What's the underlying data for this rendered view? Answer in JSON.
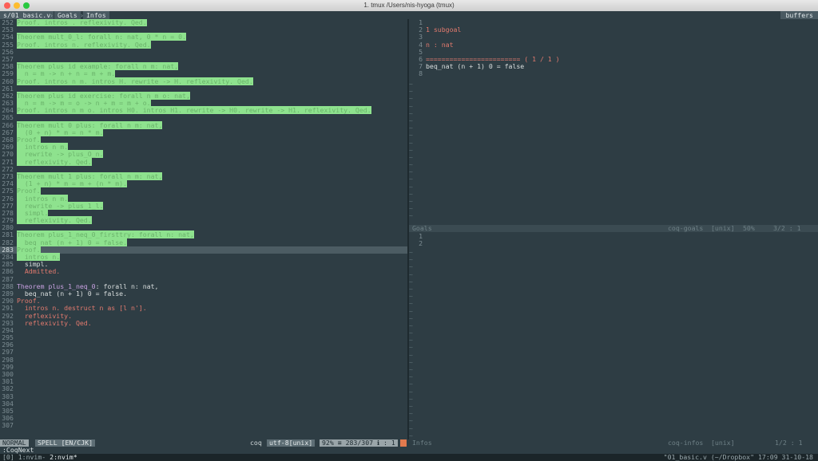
{
  "window": {
    "title": "1. tmux  /Users/nis-hyoga (tmux)"
  },
  "tabline": {
    "tabs": [
      "s/01_basic.v",
      "Goals",
      "Infos"
    ],
    "buffers_label": "buffers"
  },
  "left_pane": {
    "lines": [
      {
        "n": "252",
        "segs": [
          {
            "t": "Proof. intros . reflexivity. Qed.",
            "c": "hl"
          }
        ]
      },
      {
        "n": "253",
        "segs": []
      },
      {
        "n": "254",
        "segs": [
          {
            "t": "Theorem mult_0_l: forall n: nat, 0 * n = 0.",
            "c": "hl"
          }
        ]
      },
      {
        "n": "255",
        "segs": [
          {
            "t": "Proof. intros n. reflexivity. Qed.",
            "c": "hl"
          }
        ]
      },
      {
        "n": "256",
        "segs": []
      },
      {
        "n": "257",
        "segs": []
      },
      {
        "n": "258",
        "segs": [
          {
            "t": "Theorem plus_id_example: forall n m: nat,",
            "c": "hl"
          }
        ]
      },
      {
        "n": "259",
        "segs": [
          {
            "t": "  n = m -> n + n = m + m.",
            "c": "hl"
          }
        ]
      },
      {
        "n": "260",
        "segs": [
          {
            "t": "Proof. intros n m. intros H. rewrite -> H. reflexivity. Qed.",
            "c": "hl"
          }
        ]
      },
      {
        "n": "261",
        "segs": []
      },
      {
        "n": "262",
        "segs": [
          {
            "t": "Theorem plus_id_exercise: forall n m o: nat,",
            "c": "hl"
          }
        ]
      },
      {
        "n": "263",
        "segs": [
          {
            "t": "  n = m -> m = o -> n + m = m + o.",
            "c": "hl"
          }
        ]
      },
      {
        "n": "264",
        "segs": [
          {
            "t": "Proof. intros n m o. intros H0. intros H1. rewrite -> H0. rewrite -> H1. reflexivity. Qed.",
            "c": "hl"
          }
        ]
      },
      {
        "n": "265",
        "segs": []
      },
      {
        "n": "266",
        "segs": [
          {
            "t": "Theorem mult_0_plus: forall n m: nat,",
            "c": "hl"
          }
        ]
      },
      {
        "n": "267",
        "segs": [
          {
            "t": "  (0 + n) * m = n * m.",
            "c": "hl"
          }
        ]
      },
      {
        "n": "268",
        "segs": [
          {
            "t": "Proof.",
            "c": "hl"
          }
        ]
      },
      {
        "n": "269",
        "segs": [
          {
            "t": "  intros n m.",
            "c": "hl"
          }
        ]
      },
      {
        "n": "270",
        "segs": [
          {
            "t": "  rewrite -> plus_O_n.",
            "c": "hl"
          }
        ]
      },
      {
        "n": "271",
        "segs": [
          {
            "t": "  reflexivity. Qed.",
            "c": "hl"
          }
        ]
      },
      {
        "n": "272",
        "segs": []
      },
      {
        "n": "273",
        "segs": [
          {
            "t": "Theorem mult_1_plus: forall n m: nat,",
            "c": "hl"
          }
        ]
      },
      {
        "n": "274",
        "segs": [
          {
            "t": "  (1 + n) * m = m + (n * m).",
            "c": "hl"
          }
        ]
      },
      {
        "n": "275",
        "segs": [
          {
            "t": "Proof.",
            "c": "hl"
          }
        ]
      },
      {
        "n": "276",
        "segs": [
          {
            "t": "  intros n m.",
            "c": "hl"
          }
        ]
      },
      {
        "n": "277",
        "segs": [
          {
            "t": "  rewrite -> plus_1_l.",
            "c": "hl"
          }
        ]
      },
      {
        "n": "278",
        "segs": [
          {
            "t": "  simpl.",
            "c": "hl"
          }
        ]
      },
      {
        "n": "279",
        "segs": [
          {
            "t": "  reflexivity. Qed.",
            "c": "hl"
          }
        ]
      },
      {
        "n": "280",
        "segs": []
      },
      {
        "n": "281",
        "segs": [
          {
            "t": "Theorem plus_1_neq_0_firsttry: forall n: nat,",
            "c": "hl"
          }
        ]
      },
      {
        "n": "282",
        "segs": [
          {
            "t": "  beq_nat (n + 1) 0 = false.",
            "c": "hl"
          }
        ]
      },
      {
        "n": "283",
        "cur": true,
        "segs": [
          {
            "t": "Proof.",
            "c": "hl"
          }
        ]
      },
      {
        "n": "284",
        "segs": [
          {
            "t": "  intros n.",
            "c": "hl"
          }
        ]
      },
      {
        "n": "285",
        "segs": [
          {
            "t": "  simpl.",
            "c": "ident"
          }
        ]
      },
      {
        "n": "286",
        "segs": [
          {
            "t": "  Admitted.",
            "c": "kw2"
          }
        ]
      },
      {
        "n": "287",
        "segs": []
      },
      {
        "n": "288",
        "segs": [
          {
            "t": "Theorem ",
            "c": "kw"
          },
          {
            "t": "plus_1_neq_0",
            "c": "kw"
          },
          {
            "t": ": forall n: nat,",
            "c": "ident"
          }
        ]
      },
      {
        "n": "289",
        "segs": [
          {
            "t": "  beq_nat (n + 1) 0 = false.",
            "c": "ident"
          }
        ]
      },
      {
        "n": "290",
        "segs": [
          {
            "t": "Proof.",
            "c": "kw2"
          }
        ]
      },
      {
        "n": "291",
        "segs": [
          {
            "t": "  intros n. destruct n as [l n'].",
            "c": "kw2"
          }
        ]
      },
      {
        "n": "292",
        "segs": [
          {
            "t": "  reflexivity.",
            "c": "kw2"
          }
        ]
      },
      {
        "n": "293",
        "segs": [
          {
            "t": "  reflexivity. Qed.",
            "c": "kw2"
          }
        ]
      },
      {
        "n": "294",
        "segs": []
      },
      {
        "n": "295",
        "segs": []
      },
      {
        "n": "296",
        "segs": []
      },
      {
        "n": "297",
        "segs": []
      },
      {
        "n": "298",
        "segs": []
      },
      {
        "n": "299",
        "segs": []
      },
      {
        "n": "300",
        "segs": []
      },
      {
        "n": "301",
        "segs": []
      },
      {
        "n": "302",
        "segs": []
      },
      {
        "n": "303",
        "segs": []
      },
      {
        "n": "304",
        "segs": []
      },
      {
        "n": "305",
        "segs": []
      },
      {
        "n": "306",
        "segs": []
      },
      {
        "n": "307",
        "segs": []
      }
    ]
  },
  "goals_pane": {
    "lines": [
      {
        "n": "1",
        "segs": []
      },
      {
        "n": "2",
        "segs": [
          {
            "t": "1 subgoal",
            "c": "kw2"
          }
        ]
      },
      {
        "n": "3",
        "segs": []
      },
      {
        "n": "4",
        "segs": [
          {
            "t": "n : nat",
            "c": "kw2"
          }
        ]
      },
      {
        "n": "5",
        "segs": []
      },
      {
        "n": "6",
        "segs": [
          {
            "t": "======================== ( 1 / 1 )",
            "c": "kw2"
          }
        ]
      },
      {
        "n": "7",
        "segs": [
          {
            "t": "beq_nat (n + 1) 0 = false",
            "c": "ident"
          }
        ]
      },
      {
        "n": "8",
        "segs": []
      }
    ],
    "status": {
      "name": "Goals",
      "ft": "coq-goals",
      "enc": "[unix]",
      "pct": "50%",
      "pos": "3/2 : 1"
    }
  },
  "infos_pane": {
    "lines": [
      {
        "n": "1",
        "segs": []
      },
      {
        "n": "2",
        "segs": []
      }
    ]
  },
  "statusline": {
    "mode": "NORMAL",
    "spell": "SPELL [EN/CJK]",
    "filetype": "coq",
    "encoding": "utf-8[unix]",
    "position": "92% ≡ 283/307 ℹ : 1",
    "right_name": "Infos",
    "right_ft": "coq-infos",
    "right_enc": "[unix]",
    "right_pos": "1/2 : 1"
  },
  "cmdline": ":CoqNext",
  "tmux": {
    "left": "[0] 1:nvim- ",
    "current": "2:nvim*",
    "right": "\"01_basic.v (~/Dropbox\" 17:09 31-10-18"
  },
  "colors": {
    "highlight": "#8ee28e",
    "background": "#2e3d44",
    "cursorline": "#4c5c63"
  }
}
